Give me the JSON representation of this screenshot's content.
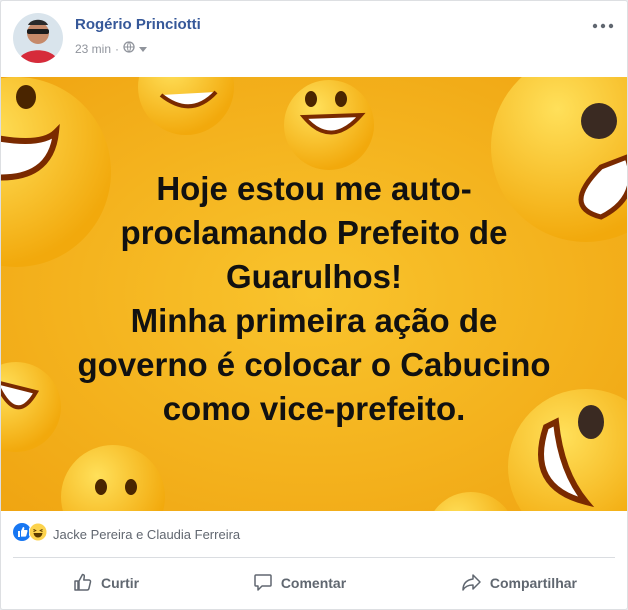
{
  "post": {
    "author": "Rogério Princiotti",
    "time": "23 min",
    "separator": "·",
    "privacy_icon": "globe-icon",
    "more_icon": "more-options-icon"
  },
  "banner": {
    "lines": [
      "Hoje estou me auto-",
      "proclamando Prefeito de",
      "Guarulhos!",
      "Minha primeira ação de",
      "governo é colocar o Cabucino",
      "como vice-prefeito."
    ],
    "background_color": "#f6b21a",
    "theme": "smiley-emoji-pattern"
  },
  "reactions": {
    "icons": [
      "like-icon",
      "haha-icon"
    ],
    "names": "Jacke Pereira e Claudia Ferreira"
  },
  "actions": {
    "like": "Curtir",
    "comment": "Comentar",
    "share": "Compartilhar"
  },
  "colors": {
    "link": "#365899",
    "like_blue": "#1877f2",
    "muted": "#90949c"
  }
}
